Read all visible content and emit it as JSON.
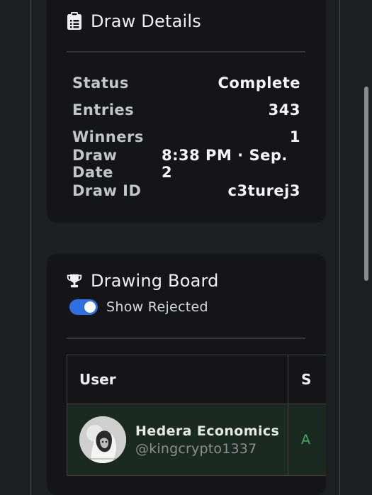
{
  "details": {
    "title": "Draw Details",
    "icon": "clipboard-icon",
    "rows": [
      {
        "label": "Status",
        "value": "Complete"
      },
      {
        "label": "Entries",
        "value": "343"
      },
      {
        "label": "Winners",
        "value": "1"
      },
      {
        "label": "Draw Date",
        "value": "8:38 PM · Sep. 2"
      },
      {
        "label": "Draw ID",
        "value": "c3turej3"
      }
    ]
  },
  "board": {
    "title": "Drawing Board",
    "icon": "trophy-icon",
    "toggle": {
      "label": "Show Rejected",
      "on": true
    },
    "columns": [
      "User",
      "S"
    ],
    "rows": [
      {
        "name": "Hedera Economics",
        "handle": "@kingcrypto1337",
        "status": "A"
      }
    ]
  },
  "colors": {
    "accent": "#2f6fe0",
    "accepted": "#3fae5c",
    "card": "#151517",
    "background": "#1d1e20"
  }
}
